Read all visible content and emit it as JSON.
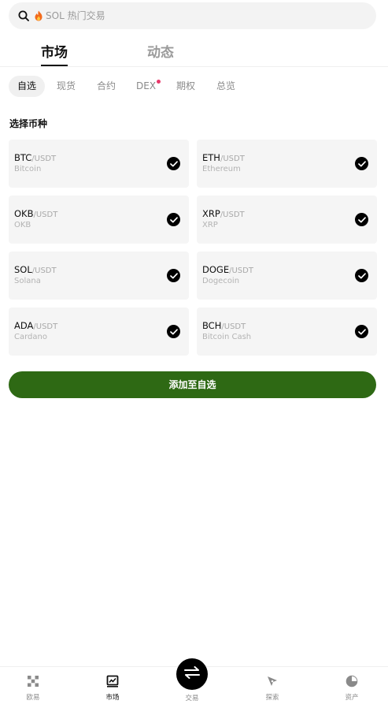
{
  "search": {
    "placeholder": "SOL 热门交易"
  },
  "main_tabs": [
    {
      "label": "市场"
    },
    {
      "label": "动态"
    }
  ],
  "sub_tabs": [
    {
      "label": "自选"
    },
    {
      "label": "现货"
    },
    {
      "label": "合约"
    },
    {
      "label": "DEX"
    },
    {
      "label": "期权"
    },
    {
      "label": "总览"
    }
  ],
  "section_title": "选择币种",
  "coins": [
    {
      "base": "BTC",
      "quote": "/USDT",
      "name": "Bitcoin",
      "selected": true
    },
    {
      "base": "ETH",
      "quote": "/USDT",
      "name": "Ethereum",
      "selected": true
    },
    {
      "base": "OKB",
      "quote": "/USDT",
      "name": "OKB",
      "selected": true
    },
    {
      "base": "XRP",
      "quote": "/USDT",
      "name": "XRP",
      "selected": true
    },
    {
      "base": "SOL",
      "quote": "/USDT",
      "name": "Solana",
      "selected": true
    },
    {
      "base": "DOGE",
      "quote": "/USDT",
      "name": "Dogecoin",
      "selected": true
    },
    {
      "base": "ADA",
      "quote": "/USDT",
      "name": "Cardano",
      "selected": true
    },
    {
      "base": "BCH",
      "quote": "/USDT",
      "name": "Bitcoin Cash",
      "selected": true
    }
  ],
  "add_button": {
    "label": "添加至自选"
  },
  "bottom_nav": [
    {
      "label": "欧易",
      "icon": "okx-logo-icon"
    },
    {
      "label": "市场",
      "icon": "chart-icon"
    },
    {
      "label": "交易",
      "icon": "swap-arrows-icon"
    },
    {
      "label": "探索",
      "icon": "compass-icon"
    },
    {
      "label": "资产",
      "icon": "pie-chart-icon"
    }
  ],
  "colors": {
    "accent": "#2e6914",
    "dex_dot": "#e9386a"
  }
}
